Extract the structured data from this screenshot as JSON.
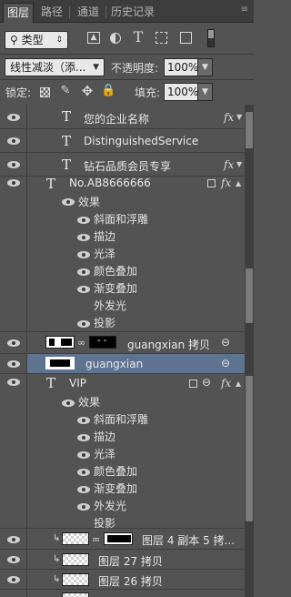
{
  "tabs": [
    {
      "label": "图层",
      "active": true
    },
    {
      "label": "路径",
      "active": false
    },
    {
      "label": "通道",
      "active": false
    },
    {
      "label": "历史记录",
      "active": false
    }
  ],
  "filter": {
    "kind_label": "类型",
    "icons": [
      "image-filter-icon",
      "adjustment-filter-icon",
      "text-filter-icon",
      "shape-filter-icon",
      "smart-object-filter-icon",
      "filter-toggle-icon"
    ]
  },
  "blend": {
    "mode": "线性减淡（添...",
    "opacity_label": "不透明度:",
    "opacity_value": "100%"
  },
  "lock": {
    "label": "锁定:",
    "fill_label": "填充:",
    "fill_value": "100%"
  },
  "layers": {
    "r1": {
      "name": "您的企业名称",
      "fx": "fx"
    },
    "r2": {
      "name": "DistinguishedService"
    },
    "r3": {
      "name": "钻石品质会员专享",
      "fx": "fx"
    },
    "r4": {
      "name": "No.AB8666666",
      "fx": "fx"
    },
    "r4_effects": {
      "title": "效果",
      "items": [
        "斜面和浮雕",
        "描边",
        "光泽",
        "颜色叠加",
        "渐变叠加",
        "外发光",
        "投影"
      ]
    },
    "r5": {
      "name": "guangxian 拷贝",
      "mask_text": "- -"
    },
    "r6": {
      "name": "guangxian"
    },
    "r7": {
      "name": "VIP",
      "fx": "fx"
    },
    "r7_effects": {
      "title": "效果",
      "items": [
        "斜面和浮雕",
        "描边",
        "光泽",
        "颜色叠加",
        "渐变叠加",
        "外发光",
        "投影"
      ]
    },
    "r8": {
      "name": "图层 4 副本 5 拷..."
    },
    "r9": {
      "name": "图层 27 拷贝"
    },
    "r10": {
      "name": "图层 26 拷贝"
    }
  }
}
